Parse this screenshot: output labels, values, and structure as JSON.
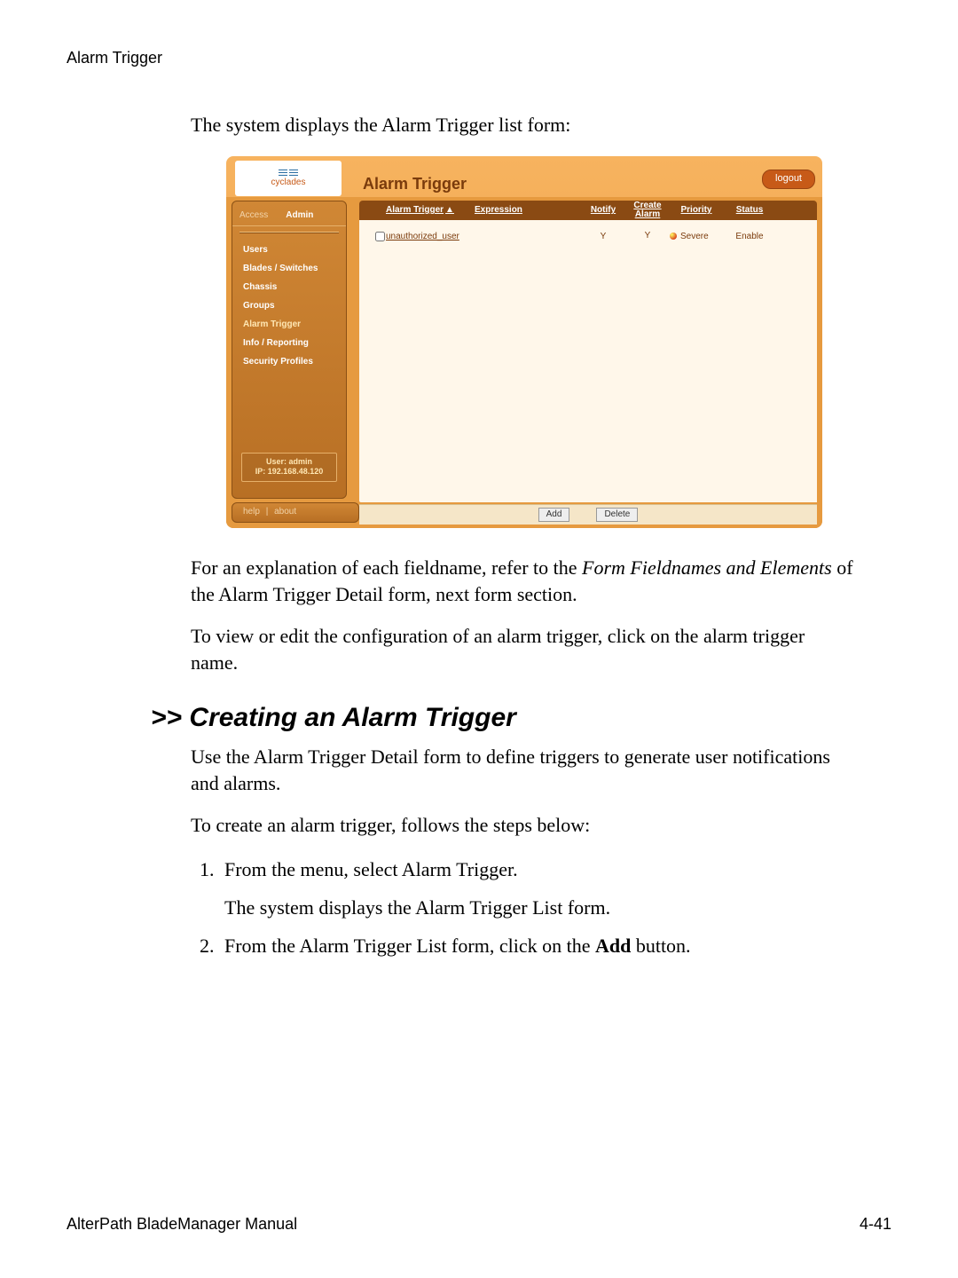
{
  "page_header": "Alarm Trigger",
  "intro_text": "The system displays the Alarm Trigger list form:",
  "app": {
    "brand": "cyclades",
    "title": "Alarm Trigger",
    "logout": "logout",
    "tabs": {
      "access": "Access",
      "admin": "Admin"
    },
    "sidebar_items": [
      "Users",
      "Blades / Switches",
      "Chassis",
      "Groups",
      "Alarm Trigger",
      "Info / Reporting",
      "Security Profiles"
    ],
    "active_sidebar_index": 4,
    "userbox_line1": "User: admin",
    "userbox_line2": "IP: 192.168.48.120",
    "columns": {
      "alarm_trigger": "Alarm Trigger",
      "expression": "Expression",
      "notify": "Notify",
      "create_alarm": "Create Alarm",
      "priority": "Priority",
      "status": "Status"
    },
    "row": {
      "name": "unauthorized_user",
      "notify": "Y",
      "create_alarm": "Y",
      "priority": "Severe",
      "status": "Enable"
    },
    "buttons": {
      "add": "Add",
      "delete": "Delete"
    },
    "help": "help",
    "about": "about"
  },
  "after_screenshot_p1_a": "For an explanation of each fieldname, refer to the ",
  "after_screenshot_p1_b": "Form Fieldnames and Elements",
  "after_screenshot_p1_c": " of the Alarm Trigger Detail form, next form section.",
  "after_screenshot_p2": "To view or edit the configuration of an alarm trigger, click on the alarm trigger name.",
  "section_heading": ">> Creating an Alarm Trigger",
  "creating_p1": "Use the Alarm Trigger Detail form to define triggers to generate user notifications and alarms.",
  "creating_p2": "To create an alarm trigger, follows the steps below:",
  "step1_a": "From the menu, select Alarm Trigger.",
  "step1_b": "The system displays the Alarm Trigger List form.",
  "step2_pre": "From the Alarm Trigger List form, click on the ",
  "step2_bold": "Add",
  "step2_post": " button.",
  "footer_left": "AlterPath BladeManager Manual",
  "footer_right": "4-41"
}
